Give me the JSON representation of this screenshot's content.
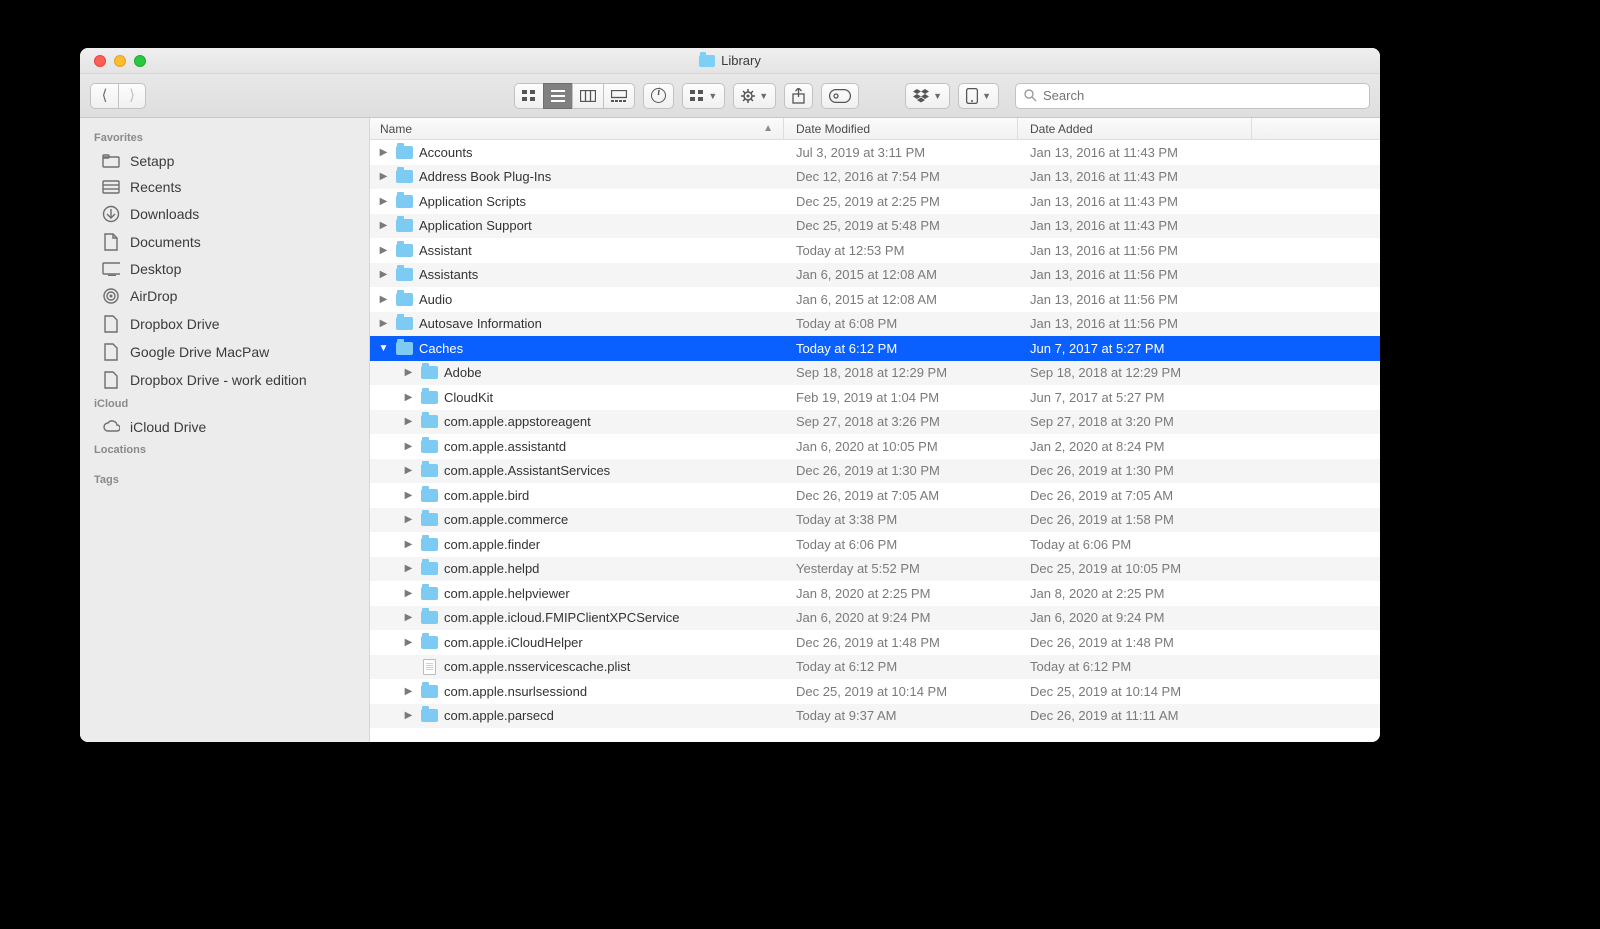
{
  "window": {
    "title": "Library"
  },
  "toolbar": {
    "search_placeholder": "Search"
  },
  "sidebar": {
    "sections": [
      {
        "header": "Favorites",
        "items": [
          {
            "icon": "folder",
            "label": "Setapp"
          },
          {
            "icon": "recents",
            "label": "Recents"
          },
          {
            "icon": "downloads",
            "label": "Downloads"
          },
          {
            "icon": "documents",
            "label": "Documents"
          },
          {
            "icon": "desktop",
            "label": "Desktop"
          },
          {
            "icon": "airdrop",
            "label": "AirDrop"
          },
          {
            "icon": "doc",
            "label": "Dropbox Drive"
          },
          {
            "icon": "doc",
            "label": "Google Drive MacPaw"
          },
          {
            "icon": "doc",
            "label": "Dropbox Drive - work edition"
          }
        ]
      },
      {
        "header": "iCloud",
        "items": [
          {
            "icon": "cloud",
            "label": "iCloud Drive"
          }
        ]
      },
      {
        "header": "Locations",
        "items": []
      },
      {
        "header": "Tags",
        "items": []
      }
    ]
  },
  "columns": {
    "name": "Name",
    "date_modified": "Date Modified",
    "date_added": "Date Added"
  },
  "rows": [
    {
      "indent": 0,
      "expand": "closed",
      "icon": "folder",
      "name": "Accounts",
      "dm": "Jul 3, 2019 at 3:11 PM",
      "da": "Jan 13, 2016 at 11:43 PM"
    },
    {
      "indent": 0,
      "expand": "closed",
      "icon": "folder",
      "name": "Address Book Plug-Ins",
      "dm": "Dec 12, 2016 at 7:54 PM",
      "da": "Jan 13, 2016 at 11:43 PM"
    },
    {
      "indent": 0,
      "expand": "closed",
      "icon": "folder",
      "name": "Application Scripts",
      "dm": "Dec 25, 2019 at 2:25 PM",
      "da": "Jan 13, 2016 at 11:43 PM"
    },
    {
      "indent": 0,
      "expand": "closed",
      "icon": "folder",
      "name": "Application Support",
      "dm": "Dec 25, 2019 at 5:48 PM",
      "da": "Jan 13, 2016 at 11:43 PM"
    },
    {
      "indent": 0,
      "expand": "closed",
      "icon": "folder",
      "name": "Assistant",
      "dm": "Today at 12:53 PM",
      "da": "Jan 13, 2016 at 11:56 PM"
    },
    {
      "indent": 0,
      "expand": "closed",
      "icon": "folder",
      "name": "Assistants",
      "dm": "Jan 6, 2015 at 12:08 AM",
      "da": "Jan 13, 2016 at 11:56 PM"
    },
    {
      "indent": 0,
      "expand": "closed",
      "icon": "folder",
      "name": "Audio",
      "dm": "Jan 6, 2015 at 12:08 AM",
      "da": "Jan 13, 2016 at 11:56 PM"
    },
    {
      "indent": 0,
      "expand": "closed",
      "icon": "folder",
      "name": "Autosave Information",
      "dm": "Today at 6:08 PM",
      "da": "Jan 13, 2016 at 11:56 PM"
    },
    {
      "indent": 0,
      "expand": "open",
      "icon": "folder",
      "name": "Caches",
      "dm": "Today at 6:12 PM",
      "da": "Jun 7, 2017 at 5:27 PM",
      "selected": true
    },
    {
      "indent": 1,
      "expand": "closed",
      "icon": "folder",
      "name": "Adobe",
      "dm": "Sep 18, 2018 at 12:29 PM",
      "da": "Sep 18, 2018 at 12:29 PM"
    },
    {
      "indent": 1,
      "expand": "closed",
      "icon": "folder",
      "name": "CloudKit",
      "dm": "Feb 19, 2019 at 1:04 PM",
      "da": "Jun 7, 2017 at 5:27 PM"
    },
    {
      "indent": 1,
      "expand": "closed",
      "icon": "folder",
      "name": "com.apple.appstoreagent",
      "dm": "Sep 27, 2018 at 3:26 PM",
      "da": "Sep 27, 2018 at 3:20 PM"
    },
    {
      "indent": 1,
      "expand": "closed",
      "icon": "folder",
      "name": "com.apple.assistantd",
      "dm": "Jan 6, 2020 at 10:05 PM",
      "da": "Jan 2, 2020 at 8:24 PM"
    },
    {
      "indent": 1,
      "expand": "closed",
      "icon": "folder",
      "name": "com.apple.AssistantServices",
      "dm": "Dec 26, 2019 at 1:30 PM",
      "da": "Dec 26, 2019 at 1:30 PM"
    },
    {
      "indent": 1,
      "expand": "closed",
      "icon": "folder",
      "name": "com.apple.bird",
      "dm": "Dec 26, 2019 at 7:05 AM",
      "da": "Dec 26, 2019 at 7:05 AM"
    },
    {
      "indent": 1,
      "expand": "closed",
      "icon": "folder",
      "name": "com.apple.commerce",
      "dm": "Today at 3:38 PM",
      "da": "Dec 26, 2019 at 1:58 PM"
    },
    {
      "indent": 1,
      "expand": "closed",
      "icon": "folder",
      "name": "com.apple.finder",
      "dm": "Today at 6:06 PM",
      "da": "Today at 6:06 PM"
    },
    {
      "indent": 1,
      "expand": "closed",
      "icon": "folder",
      "name": "com.apple.helpd",
      "dm": "Yesterday at 5:52 PM",
      "da": "Dec 25, 2019 at 10:05 PM"
    },
    {
      "indent": 1,
      "expand": "closed",
      "icon": "folder",
      "name": "com.apple.helpviewer",
      "dm": "Jan 8, 2020 at 2:25 PM",
      "da": "Jan 8, 2020 at 2:25 PM"
    },
    {
      "indent": 1,
      "expand": "closed",
      "icon": "folder",
      "name": "com.apple.icloud.FMIPClientXPCService",
      "dm": "Jan 6, 2020 at 9:24 PM",
      "da": "Jan 6, 2020 at 9:24 PM"
    },
    {
      "indent": 1,
      "expand": "closed",
      "icon": "folder",
      "name": "com.apple.iCloudHelper",
      "dm": "Dec 26, 2019 at 1:48 PM",
      "da": "Dec 26, 2019 at 1:48 PM"
    },
    {
      "indent": 1,
      "expand": "none",
      "icon": "doc",
      "name": "com.apple.nsservicescache.plist",
      "dm": "Today at 6:12 PM",
      "da": "Today at 6:12 PM"
    },
    {
      "indent": 1,
      "expand": "closed",
      "icon": "folder",
      "name": "com.apple.nsurlsessiond",
      "dm": "Dec 25, 2019 at 10:14 PM",
      "da": "Dec 25, 2019 at 10:14 PM"
    },
    {
      "indent": 1,
      "expand": "closed",
      "icon": "folder",
      "name": "com.apple.parsecd",
      "dm": "Today at 9:37 AM",
      "da": "Dec 26, 2019 at 11:11 AM"
    }
  ]
}
